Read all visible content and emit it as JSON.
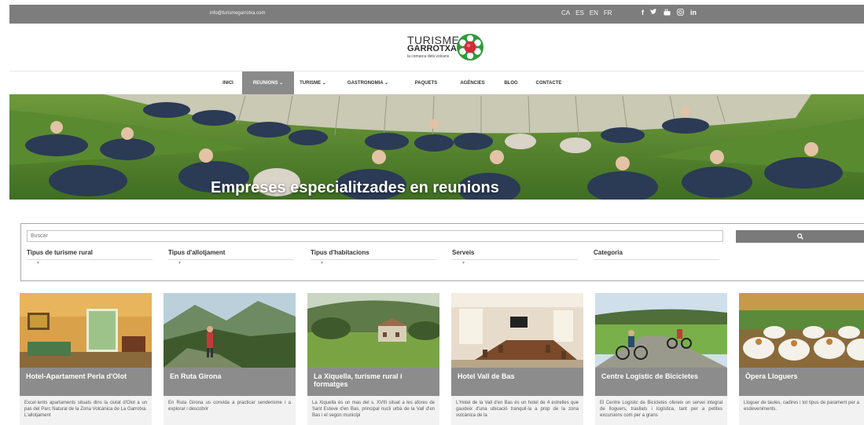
{
  "topbar": {
    "email": "info@turismegarrotxa.com",
    "languages": [
      "CA",
      "ES",
      "EN",
      "FR"
    ],
    "social_icons": [
      "facebook-icon",
      "twitter-icon",
      "youtube-icon",
      "instagram-icon",
      "linkedin-icon"
    ]
  },
  "logo": {
    "line1": "TURISME",
    "line2": "GARROTXA",
    "tagline": "la comarca dels volcans"
  },
  "nav": {
    "items": [
      {
        "label": "INICI"
      },
      {
        "label": "REUNIONS ⌄",
        "active": true
      },
      {
        "label": "TURISME ⌄"
      },
      {
        "label": "GASTRONOMIA ⌄"
      },
      {
        "label": "PAQUETS"
      },
      {
        "label": "AGÈNCIES"
      },
      {
        "label": "BLOG"
      },
      {
        "label": "CONTACTE"
      }
    ]
  },
  "hero": {
    "title": "Empreses especialitzades en reunions"
  },
  "search": {
    "placeholder": "Buscar",
    "button_icon": "search-icon",
    "filters": [
      "Tipus de turisme rural",
      "Tipus d'allotjament",
      "Tipus d'habitacions",
      "Serveis",
      "Categoria"
    ]
  },
  "cards": [
    {
      "title": "Hotel-Apartament Perla d'Olot",
      "desc": "Excel·lents apartaments situats dins la ciutat d'Olot a un pas del Parc Natural de la Zona Volcànica de La Garrotxa. L'allotjament"
    },
    {
      "title": "En Ruta Girona",
      "desc": "En Ruta Girona us convida a practicar senderisme i a explorar i descobrir"
    },
    {
      "title": "La Xiquella, turisme rural i formatges",
      "desc": "La Xiquella és un mas del s. XVIII situat a les afores de Sant Esteve d'en Bas, principal nucli urbà de la Vall d'en Bas i el segon municipi"
    },
    {
      "title": "Hotel Vall de Bas",
      "desc": "L'Hotel de la Vall d'en Bas és un hotel de 4 estrelles que gaudeix d'una ubicació tranquil·la a prop de la zona volcànica de la"
    },
    {
      "title": "Centre Logístic de Bicicletes",
      "desc": "El Centre Logistic de Bicicletes ofereix un servei integral de lloguers, trasllats i logística, tant per a petites excursions com per a grans"
    },
    {
      "title": "Òpera Lloguers",
      "desc": "Lloguer de taules, cadires i tot tipus de parament per a esdeveniments."
    }
  ],
  "colors": {
    "topbar": "#7d7d7d",
    "nav_active": "#8a8a8a",
    "card_title_bg": "#8c8c8c",
    "logo_green": "#2e9a3a",
    "logo_red": "#d8283a"
  }
}
